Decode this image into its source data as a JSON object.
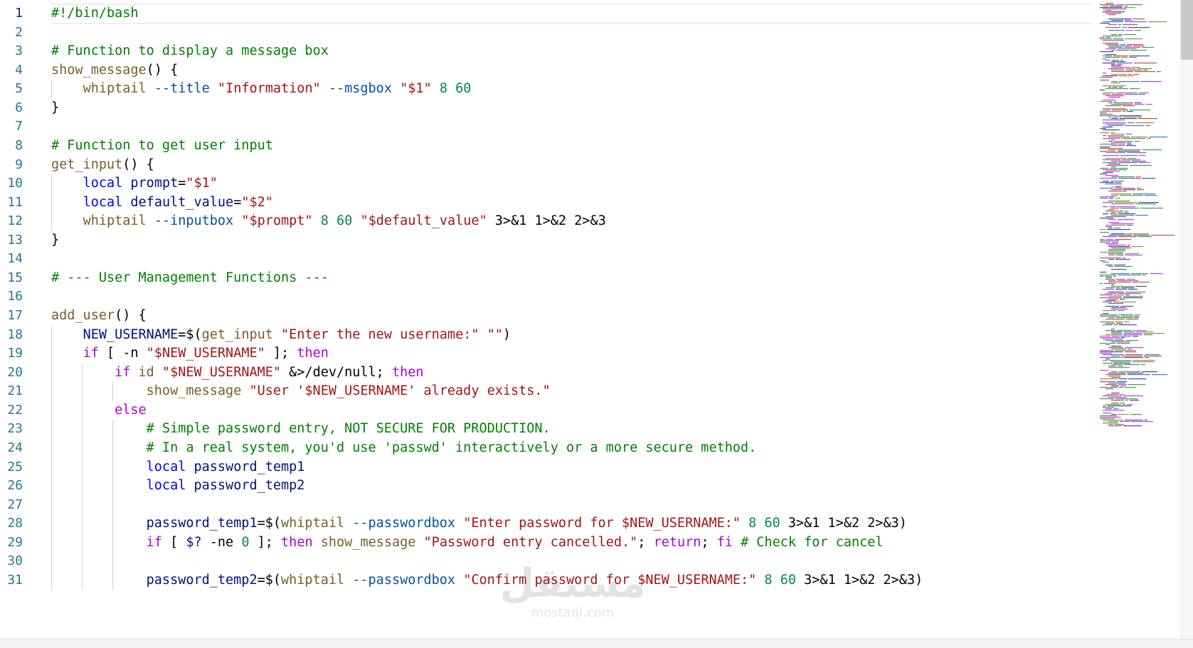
{
  "editor": {
    "lines": [
      [
        {
          "t": "#!/bin/bash",
          "c": "comment"
        }
      ],
      [],
      [
        {
          "t": "# Function to display a message box",
          "c": "comment"
        }
      ],
      [
        {
          "t": "show_message",
          "c": "fn"
        },
        {
          "t": "() {",
          "c": "text"
        }
      ],
      [
        {
          "t": "    ",
          "c": "text"
        },
        {
          "t": "whiptail",
          "c": "fn"
        },
        {
          "t": " ",
          "c": "text"
        },
        {
          "t": "--title",
          "c": "flag"
        },
        {
          "t": " ",
          "c": "text"
        },
        {
          "t": "\"Information\"",
          "c": "string"
        },
        {
          "t": " ",
          "c": "text"
        },
        {
          "t": "--msgbox",
          "c": "flag"
        },
        {
          "t": " ",
          "c": "text"
        },
        {
          "t": "\"$1\"",
          "c": "string"
        },
        {
          "t": " ",
          "c": "text"
        },
        {
          "t": "8",
          "c": "number"
        },
        {
          "t": " ",
          "c": "text"
        },
        {
          "t": "60",
          "c": "number"
        }
      ],
      [
        {
          "t": "}",
          "c": "text"
        }
      ],
      [],
      [
        {
          "t": "# Function to get user input",
          "c": "comment"
        }
      ],
      [
        {
          "t": "get_input",
          "c": "fn"
        },
        {
          "t": "() {",
          "c": "text"
        }
      ],
      [
        {
          "t": "    ",
          "c": "text"
        },
        {
          "t": "local",
          "c": "keyword"
        },
        {
          "t": " ",
          "c": "text"
        },
        {
          "t": "prompt",
          "c": "var"
        },
        {
          "t": "=",
          "c": "text"
        },
        {
          "t": "\"$1\"",
          "c": "string"
        }
      ],
      [
        {
          "t": "    ",
          "c": "text"
        },
        {
          "t": "local",
          "c": "keyword"
        },
        {
          "t": " ",
          "c": "text"
        },
        {
          "t": "default_value",
          "c": "var"
        },
        {
          "t": "=",
          "c": "text"
        },
        {
          "t": "\"$2\"",
          "c": "string"
        }
      ],
      [
        {
          "t": "    ",
          "c": "text"
        },
        {
          "t": "whiptail",
          "c": "fn"
        },
        {
          "t": " ",
          "c": "text"
        },
        {
          "t": "--inputbox",
          "c": "flag"
        },
        {
          "t": " ",
          "c": "text"
        },
        {
          "t": "\"$prompt\"",
          "c": "string"
        },
        {
          "t": " ",
          "c": "text"
        },
        {
          "t": "8",
          "c": "number"
        },
        {
          "t": " ",
          "c": "text"
        },
        {
          "t": "60",
          "c": "number"
        },
        {
          "t": " ",
          "c": "text"
        },
        {
          "t": "\"$default_value\"",
          "c": "string"
        },
        {
          "t": " 3>&1 1>&2 2>&3",
          "c": "text"
        }
      ],
      [
        {
          "t": "}",
          "c": "text"
        }
      ],
      [],
      [
        {
          "t": "# --- User Management Functions ---",
          "c": "comment"
        }
      ],
      [],
      [
        {
          "t": "add_user",
          "c": "fn"
        },
        {
          "t": "() {",
          "c": "text"
        }
      ],
      [
        {
          "t": "    ",
          "c": "text"
        },
        {
          "t": "NEW_USERNAME",
          "c": "var"
        },
        {
          "t": "=$(",
          "c": "text"
        },
        {
          "t": "get_input",
          "c": "fn"
        },
        {
          "t": " ",
          "c": "text"
        },
        {
          "t": "\"Enter the new username:\"",
          "c": "string"
        },
        {
          "t": " ",
          "c": "text"
        },
        {
          "t": "\"\"",
          "c": "string"
        },
        {
          "t": ")",
          "c": "text"
        }
      ],
      [
        {
          "t": "    ",
          "c": "text"
        },
        {
          "t": "if",
          "c": "control"
        },
        {
          "t": " [ -n ",
          "c": "text"
        },
        {
          "t": "\"$NEW_USERNAME\"",
          "c": "string"
        },
        {
          "t": " ]; ",
          "c": "text"
        },
        {
          "t": "then",
          "c": "control"
        }
      ],
      [
        {
          "t": "        ",
          "c": "text"
        },
        {
          "t": "if",
          "c": "control"
        },
        {
          "t": " ",
          "c": "text"
        },
        {
          "t": "id",
          "c": "fn"
        },
        {
          "t": " ",
          "c": "text"
        },
        {
          "t": "\"$NEW_USERNAME\"",
          "c": "string"
        },
        {
          "t": " &>/dev/null; ",
          "c": "text"
        },
        {
          "t": "then",
          "c": "control"
        }
      ],
      [
        {
          "t": "            ",
          "c": "text"
        },
        {
          "t": "show_message",
          "c": "fn"
        },
        {
          "t": " ",
          "c": "text"
        },
        {
          "t": "\"User '$NEW_USERNAME' already exists.\"",
          "c": "string"
        }
      ],
      [
        {
          "t": "        ",
          "c": "text"
        },
        {
          "t": "else",
          "c": "control"
        }
      ],
      [
        {
          "t": "            ",
          "c": "text"
        },
        {
          "t": "# Simple password entry, NOT SECURE FOR PRODUCTION.",
          "c": "comment"
        }
      ],
      [
        {
          "t": "            ",
          "c": "text"
        },
        {
          "t": "# In a real system, you'd use 'passwd' interactively or a more secure method.",
          "c": "comment"
        }
      ],
      [
        {
          "t": "            ",
          "c": "text"
        },
        {
          "t": "local",
          "c": "keyword"
        },
        {
          "t": " ",
          "c": "text"
        },
        {
          "t": "password_temp1",
          "c": "var"
        }
      ],
      [
        {
          "t": "            ",
          "c": "text"
        },
        {
          "t": "local",
          "c": "keyword"
        },
        {
          "t": " ",
          "c": "text"
        },
        {
          "t": "password_temp2",
          "c": "var"
        }
      ],
      [],
      [
        {
          "t": "            ",
          "c": "text"
        },
        {
          "t": "password_temp1",
          "c": "var"
        },
        {
          "t": "=$(",
          "c": "text"
        },
        {
          "t": "whiptail",
          "c": "fn"
        },
        {
          "t": " ",
          "c": "text"
        },
        {
          "t": "--passwordbox",
          "c": "flag"
        },
        {
          "t": " ",
          "c": "text"
        },
        {
          "t": "\"Enter password for $NEW_USERNAME:\"",
          "c": "string"
        },
        {
          "t": " ",
          "c": "text"
        },
        {
          "t": "8",
          "c": "number"
        },
        {
          "t": " ",
          "c": "text"
        },
        {
          "t": "60",
          "c": "number"
        },
        {
          "t": " 3>&1 1>&2 2>&3)",
          "c": "text"
        }
      ],
      [
        {
          "t": "            ",
          "c": "text"
        },
        {
          "t": "if",
          "c": "control"
        },
        {
          "t": " [ ",
          "c": "text"
        },
        {
          "t": "$?",
          "c": "var"
        },
        {
          "t": " -ne ",
          "c": "text"
        },
        {
          "t": "0",
          "c": "number"
        },
        {
          "t": " ]; ",
          "c": "text"
        },
        {
          "t": "then",
          "c": "control"
        },
        {
          "t": " ",
          "c": "text"
        },
        {
          "t": "show_message",
          "c": "fn"
        },
        {
          "t": " ",
          "c": "text"
        },
        {
          "t": "\"Password entry cancelled.\"",
          "c": "string"
        },
        {
          "t": "; ",
          "c": "text"
        },
        {
          "t": "return",
          "c": "control"
        },
        {
          "t": "; ",
          "c": "text"
        },
        {
          "t": "fi",
          "c": "control"
        },
        {
          "t": " ",
          "c": "text"
        },
        {
          "t": "# Check for cancel",
          "c": "comment"
        }
      ],
      [],
      [
        {
          "t": "            ",
          "c": "text"
        },
        {
          "t": "password_temp2",
          "c": "var"
        },
        {
          "t": "=$(",
          "c": "text"
        },
        {
          "t": "whiptail",
          "c": "fn"
        },
        {
          "t": " ",
          "c": "text"
        },
        {
          "t": "--passwordbox",
          "c": "flag"
        },
        {
          "t": " ",
          "c": "text"
        },
        {
          "t": "\"Confirm password for $NEW_USERNAME:\"",
          "c": "string"
        },
        {
          "t": " ",
          "c": "text"
        },
        {
          "t": "8",
          "c": "number"
        },
        {
          "t": " ",
          "c": "text"
        },
        {
          "t": "60",
          "c": "number"
        },
        {
          "t": " 3>&1 1>&2 2>&3)",
          "c": "text"
        }
      ]
    ],
    "line_numbers": [
      "1",
      "2",
      "3",
      "4",
      "5",
      "6",
      "7",
      "8",
      "9",
      "10",
      "11",
      "12",
      "13",
      "14",
      "15",
      "16",
      "17",
      "18",
      "19",
      "20",
      "21",
      "22",
      "23",
      "24",
      "25",
      "26",
      "27",
      "28",
      "29",
      "30",
      "31"
    ],
    "active_line": 1,
    "indent_guides": [
      {
        "line": 5,
        "levels": 1
      },
      {
        "line": 10,
        "levels": 1
      },
      {
        "line": 11,
        "levels": 1
      },
      {
        "line": 12,
        "levels": 1
      },
      {
        "line": 18,
        "levels": 1
      },
      {
        "line": 19,
        "levels": 1
      },
      {
        "line": 20,
        "levels": 2
      },
      {
        "line": 21,
        "levels": 3
      },
      {
        "line": 22,
        "levels": 2
      },
      {
        "line": 23,
        "levels": 3
      },
      {
        "line": 24,
        "levels": 3
      },
      {
        "line": 25,
        "levels": 3
      },
      {
        "line": 26,
        "levels": 3
      },
      {
        "line": 27,
        "levels": 3
      },
      {
        "line": 28,
        "levels": 3
      },
      {
        "line": 29,
        "levels": 3
      },
      {
        "line": 30,
        "levels": 3
      },
      {
        "line": 31,
        "levels": 3
      }
    ]
  },
  "colors": {
    "comment": "#008000",
    "keyword": "#0000ff",
    "control": "#af00db",
    "string": "#a31515",
    "number": "#098658",
    "variable": "#001080",
    "function": "#795e26",
    "flag": "#0451a5",
    "line_number": "#237893"
  },
  "watermark": {
    "main": "مستقل",
    "sub": "mostaql.com"
  }
}
